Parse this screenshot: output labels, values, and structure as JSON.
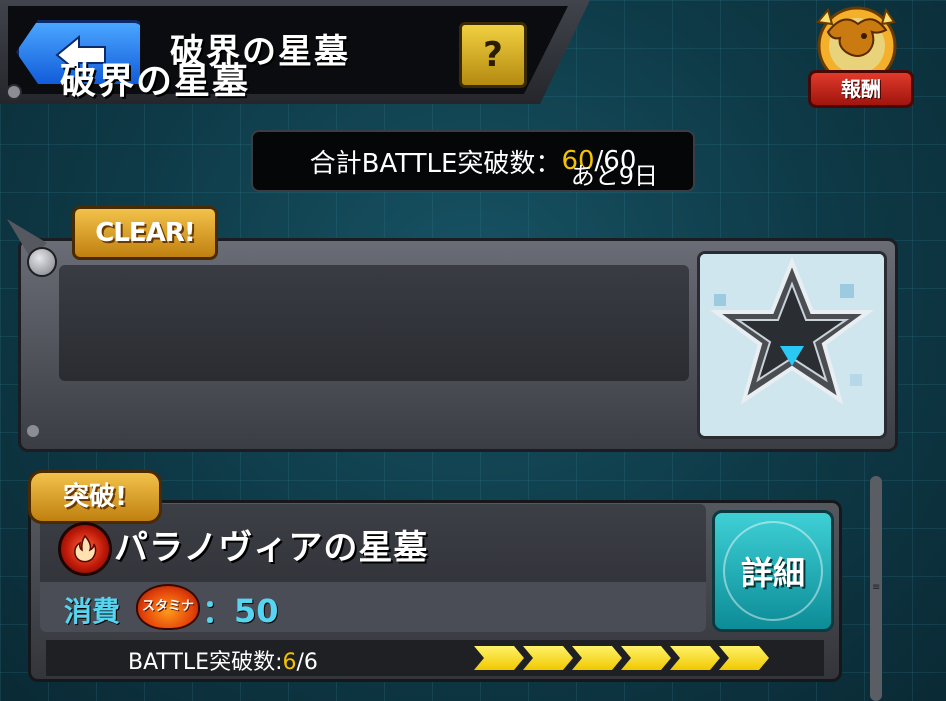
{
  "header": {
    "title": "破界の星墓",
    "help_label": "?",
    "reward_label": "報酬",
    "back_icon": "arrow-left-icon"
  },
  "summary": {
    "prefix": "合計BATTLE突破数：",
    "current": "60",
    "total": "/60"
  },
  "event": {
    "status_badge": "CLEAR!",
    "title": "破界の星墓",
    "remaining": "あと9日",
    "image_icon": "star-crystal-icon"
  },
  "quest": {
    "badge": "突破!",
    "element_icon": "fire-element-icon",
    "title": "パラノヴィアの星墓",
    "cost_label": "消費",
    "stamina_label": "スタミナ",
    "cost_value": "：50",
    "detail_label": "詳細",
    "battle_label": "BATTLE突破数:",
    "battle_current": "6",
    "battle_total": "/6",
    "progress": {
      "cleared": 6,
      "total": 6
    }
  },
  "colors": {
    "accent_yellow": "#f4c200",
    "cyan_text": "#57d4f0",
    "back_button": "#1f6ee8",
    "detail_button": "#1fb0b8"
  }
}
